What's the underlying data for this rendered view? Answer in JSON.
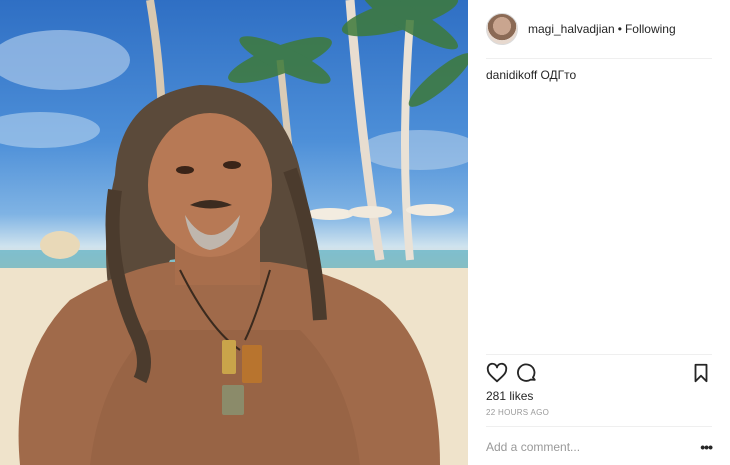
{
  "header": {
    "username": "magi_halvadjian",
    "separator": "•",
    "follow_status": "Following"
  },
  "caption": {
    "text": "danidikoff ОДГто"
  },
  "actions": {
    "like_icon": "heart-icon",
    "comment_icon": "comment-icon",
    "save_icon": "bookmark-icon"
  },
  "likes": "281 likes",
  "timestamp": "22 HOURS AGO",
  "comment": {
    "placeholder": "Add a comment...",
    "more_label": "•••"
  }
}
